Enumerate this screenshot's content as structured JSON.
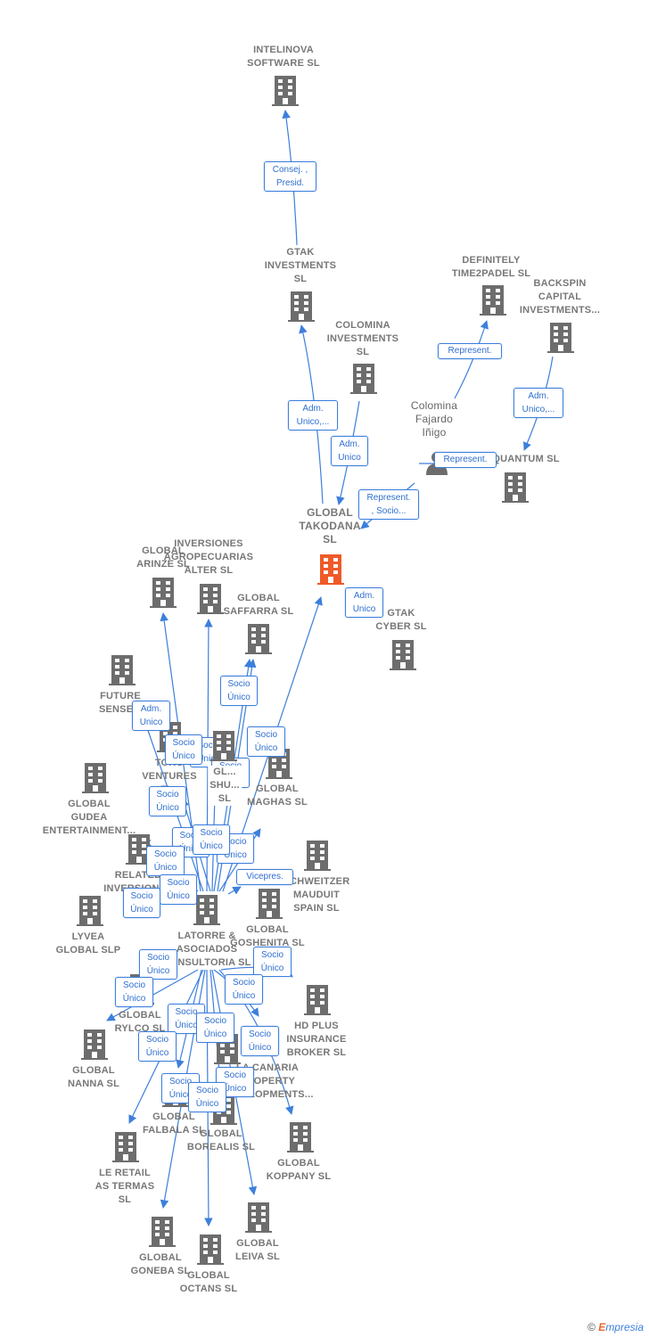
{
  "colors": {
    "edge": "#3d7fdc",
    "node": "#6d6d6d",
    "focus": "#ef5a28"
  },
  "nodes": {
    "intelinova": "INTELINOVA\nSOFTWARE SL",
    "gtak_inv": "GTAK\nINVESTMENTS\nSL",
    "definitely": "DEFINITELY\nTIME2PADEL SL",
    "backspin": "BACKSPIN\nCAPITAL\nINVESTMENTS...",
    "colomina_inv": "COLOMINA\nINVESTMENTS\nSL",
    "colomina_person": "Colomina\nFajardo\nIñigo",
    "quantum": "QUANTUM SL",
    "takodana": "GLOBAL\nTAKODANA\nSL",
    "gtak_cyber": "GTAK\nCYBER  SL",
    "arinze": "GLOBAL\nARINZE  SL",
    "alter": "INVERSIONES\nAGROPECUARIAS\nALTER  SL",
    "saffarra": "GLOBAL\nSAFFARRA  SL",
    "future": "FUTURE\nSENSE...",
    "toro": "TORO\nVENTURES\nFI...",
    "shu": "GL...\nSHU...  SL",
    "maghas": "GLOBAL\nMAGHAS  SL",
    "gudea": "GLOBAL\nGUDEA\nENTERTAINMENT...",
    "related": "RELATED\nINVERSIONES\nES...",
    "schweitzer": "SCHWEITZER\nMAUDUIT\nSPAIN SL",
    "lyvea": "LYVEA\nGLOBAL  SLP",
    "latorre": "LATORRE &\nASOCIADOS\nCONSULTORIA SL",
    "goshenita": "GLOBAL\nGOSHENITA SL",
    "hdplus": "HD PLUS\nINSURANCE\nBROKER  SL",
    "rylco": "GLOBAL\nRYLCO  SL",
    "nanna": "GLOBAL\nNANNA  SL",
    "canaria": "LA CANARIA\nPROPERTY\nDEVELOPMENTS...",
    "falbala": "GLOBAL\nFALBALA  SL",
    "borealis": "GLOBAL\nBOREALIS  SL",
    "leretail": "LE RETAIL\nAS TERMAS\nSL",
    "koppany": "GLOBAL\nKOPPANY  SL",
    "goneba": "GLOBAL\nGONEBA  SL",
    "octans": "GLOBAL\nOCTANS  SL",
    "leiva": "GLOBAL\nLEIVA  SL"
  },
  "relations": {
    "consej": "Consej. ,\nPresid.",
    "represent": "Represent.",
    "adm_unico_etc": "Adm.\nUnico,...",
    "adm_unico": "Adm.\nUnico",
    "represent_socio": "Represent.\n, Socio...",
    "socio_unico": "Socio\nÚnico",
    "vicepres": "Vicepres."
  },
  "footer": {
    "copyright": "©",
    "brand_e": "E",
    "brand_rest": "mpresia"
  }
}
